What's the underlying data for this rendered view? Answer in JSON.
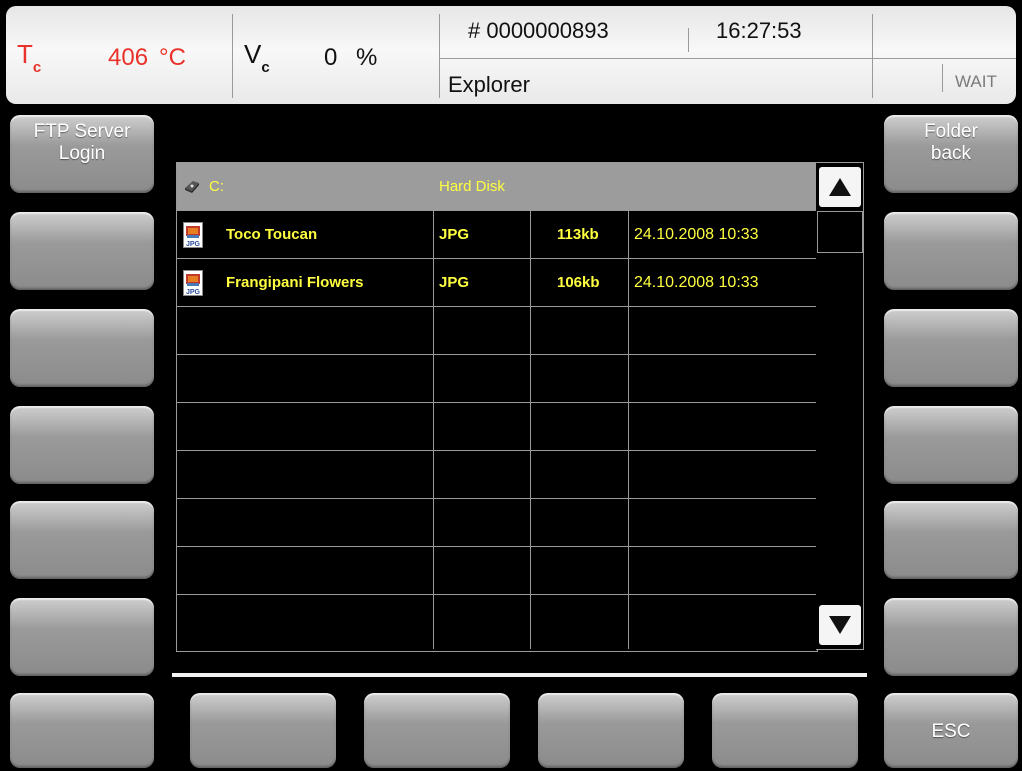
{
  "header": {
    "tc_symbol": "T",
    "tc_sub": "c",
    "tc_value": "406",
    "tc_unit": "°C",
    "vc_symbol": "V",
    "vc_sub": "c",
    "vc_value": "0",
    "vc_unit": "%",
    "counter": "# 0000000893",
    "clock": "16:27:53",
    "title": "Explorer",
    "status": "WAIT",
    "colors": {
      "temperature": "#e8322a",
      "text": "#111111"
    }
  },
  "left_keys": [
    "FTP Server\nLogin",
    "",
    "",
    "",
    "",
    ""
  ],
  "right_keys": [
    "Folder\nback",
    "",
    "",
    "",
    "",
    ""
  ],
  "bottom_keys": [
    "",
    "",
    "",
    "",
    "",
    "ESC"
  ],
  "explorer": {
    "drive": {
      "name": "C:",
      "type": "Hard Disk",
      "icon": "drive-icon"
    },
    "files": [
      {
        "name": "Toco Toucan",
        "type": "JPG",
        "size": "113kb",
        "date": "24.10.2008  10:33",
        "icon": "jpg-file-icon"
      },
      {
        "name": "Frangipani Flowers",
        "type": "JPG",
        "size": "106kb",
        "date": "24.10.2008  10:33",
        "icon": "jpg-file-icon"
      }
    ],
    "text_color": "#ffff40"
  }
}
